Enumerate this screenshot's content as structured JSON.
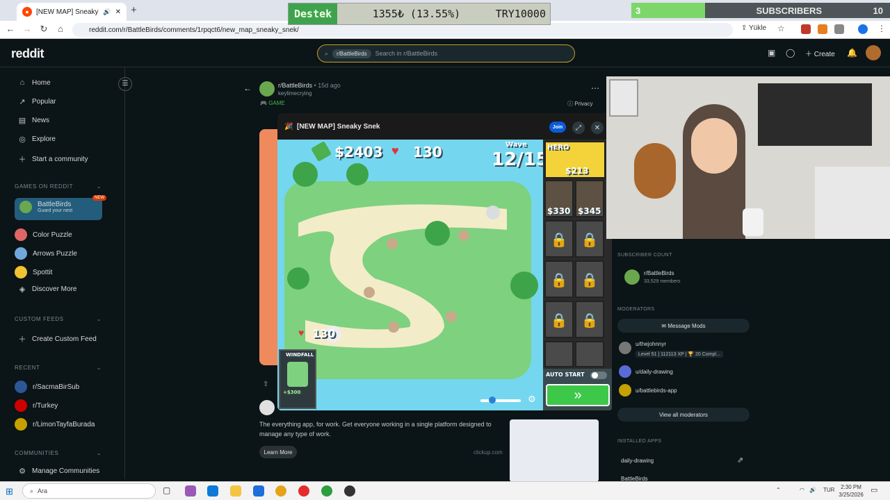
{
  "browser": {
    "tab_title": "[NEW MAP] Sneaky Sne",
    "new_tab": "+",
    "url": "reddit.com/r/BattleBirds/comments/1rpqct6/new_map_sneaky_snek/",
    "yukle": "Yükle"
  },
  "overlays": {
    "destek_label": "Destek",
    "destek_amount": "1355₺ (13.55%)",
    "destek_goal": "TRY10000",
    "subs_count": "3",
    "subs_label": "SUBSCRIBERS",
    "subs_goal": "10"
  },
  "reddit": {
    "logo": "reddit",
    "search_chip": "r/BattleBirds",
    "search_placeholder": "Search in r/BattleBirds",
    "create": "Create"
  },
  "sidebar": {
    "nav": [
      {
        "label": "Home",
        "icon": "home-icon"
      },
      {
        "label": "Popular",
        "icon": "popular-icon"
      },
      {
        "label": "News",
        "icon": "news-icon"
      },
      {
        "label": "Explore",
        "icon": "explore-icon"
      },
      {
        "label": "Start a community",
        "icon": "plus-icon"
      }
    ],
    "games_header": "GAMES ON REDDIT",
    "games": [
      {
        "label": "BattleBirds",
        "sub": "Guard your nest",
        "badge": "NEW",
        "color": "#6aa84f"
      },
      {
        "label": "Color Puzzle",
        "color": "#e06666"
      },
      {
        "label": "Arrows Puzzle",
        "color": "#6fa8dc"
      },
      {
        "label": "Spottit",
        "color": "#f1c232"
      },
      {
        "label": "Discover More",
        "color": "#888888"
      }
    ],
    "custom_header": "CUSTOM FEEDS",
    "create_feed": "Create Custom Feed",
    "recent_header": "RECENT",
    "recent": [
      {
        "label": "r/SacmaBirSub",
        "color": "#2b5797"
      },
      {
        "label": "r/Turkey",
        "color": "#cc0000"
      },
      {
        "label": "r/LimonTayfaBurada",
        "color": "#c4a000"
      }
    ],
    "communities_header": "COMMUNITIES",
    "manage": "Manage Communities"
  },
  "post": {
    "subreddit": "r/BattleBirds",
    "age": "• 15d ago",
    "author": "keylimecrying",
    "tag": "GAME",
    "privacy": "Privacy"
  },
  "game_modal": {
    "title": "[NEW MAP] Sneaky Snek",
    "join": "Join",
    "money": "$2403",
    "lives": "130",
    "wave_label": "Wave",
    "wave": "12/15",
    "nest_lives": "130",
    "hero_label": "HERO",
    "hero_cost": "$213",
    "slot_costs": [
      "$330",
      "$345"
    ],
    "windfall_label": "WINDFALL",
    "windfall_value": "+$300",
    "auto_start": "AUTO START"
  },
  "ad": {
    "text": "The everything app, for work. Get everyone working in a single platform designed to manage any type of work.",
    "learn_more": "Learn More",
    "domain": "clickup.com"
  },
  "right_panel": {
    "subscriber_count_header": "SUBSCRIBER COUNT",
    "sub_name": "r/BattleBirds",
    "sub_members": "33,529 members",
    "moderators_header": "MODERATORS",
    "message_mods": "Message Mods",
    "mods": [
      {
        "name": "u/thejohnnyr",
        "flair": "Level 51 | 112113 XP | 🏆 20 Compl..."
      },
      {
        "name": "u/daily-drawing",
        "flair": ""
      },
      {
        "name": "u/battlebirds-app",
        "flair": ""
      }
    ],
    "view_all": "View all moderators",
    "installed_header": "INSTALLED APPS",
    "apps": [
      "daily-drawing",
      "BattleBirds"
    ]
  },
  "taskbar": {
    "search": "Ara",
    "lang": "TUR",
    "time": "2:30 PM",
    "date": "3/25/2026"
  }
}
